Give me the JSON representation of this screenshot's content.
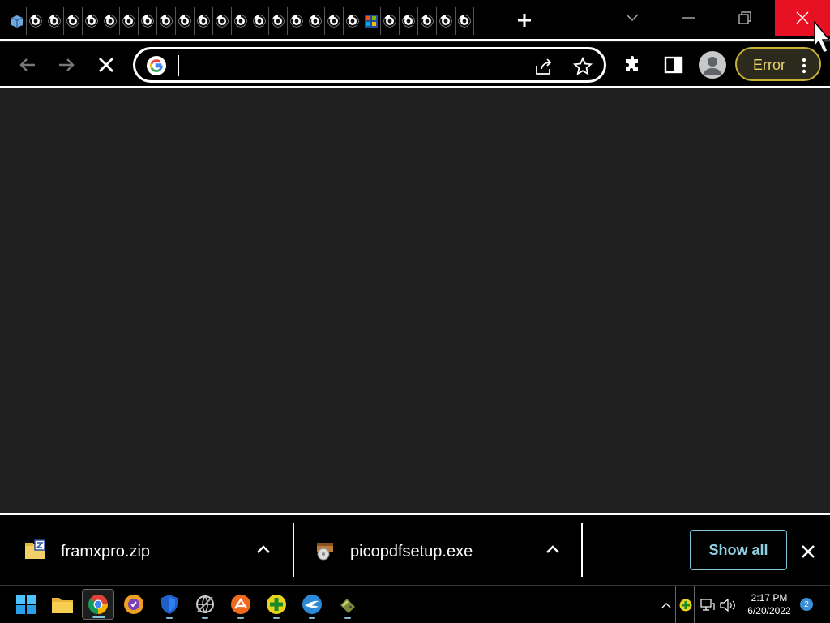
{
  "browser": {
    "omnibox": {
      "value": "",
      "placeholder": ""
    },
    "profile_status": "Error"
  },
  "tabs": [
    {
      "icon": "app-icon"
    },
    {
      "icon": "loading-icon"
    },
    {
      "icon": "loading-icon"
    },
    {
      "icon": "loading-icon"
    },
    {
      "icon": "loading-icon"
    },
    {
      "icon": "loading-icon"
    },
    {
      "icon": "loading-icon"
    },
    {
      "icon": "loading-icon"
    },
    {
      "icon": "loading-icon"
    },
    {
      "icon": "loading-icon"
    },
    {
      "icon": "loading-icon"
    },
    {
      "icon": "loading-icon"
    },
    {
      "icon": "loading-icon"
    },
    {
      "icon": "loading-icon"
    },
    {
      "icon": "loading-icon"
    },
    {
      "icon": "loading-icon"
    },
    {
      "icon": "loading-icon"
    },
    {
      "icon": "loading-icon"
    },
    {
      "icon": "loading-icon"
    },
    {
      "icon": "windows-icon"
    },
    {
      "icon": "loading-icon"
    },
    {
      "icon": "loading-icon"
    },
    {
      "icon": "loading-icon"
    },
    {
      "icon": "loading-icon"
    },
    {
      "icon": "loading-icon"
    }
  ],
  "downloads": {
    "items": [
      {
        "name": "framxpro.zip",
        "icon": "zip-file-icon"
      },
      {
        "name": "picopdfsetup.exe",
        "icon": "installer-file-icon"
      }
    ],
    "show_all_label": "Show all"
  },
  "taskbar": {
    "apps": [
      "windows-start-icon",
      "file-explorer-icon",
      "chrome-icon",
      "brave-icon",
      "shield-icon",
      "network-icon",
      "orange-app-icon",
      "green-plus-icon",
      "blue-bird-icon",
      "usb-icon"
    ],
    "clock": {
      "time": "2:17 PM",
      "date": "6/20/2022"
    },
    "notification_count": "2"
  },
  "colors": {
    "close_red": "#e81123",
    "accent": "#7fc6d8",
    "error_yellow": "#e8d56a"
  }
}
